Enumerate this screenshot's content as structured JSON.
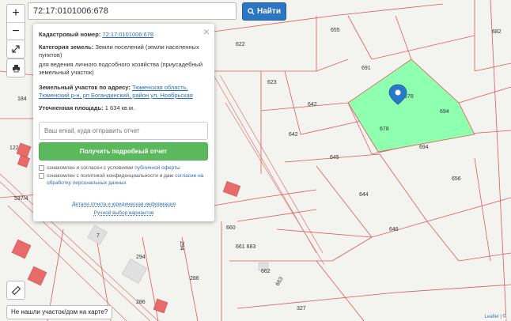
{
  "search": {
    "value": "72:17:0101006:678",
    "button_label": "Найти"
  },
  "zoom": {
    "in_label": "+",
    "out_label": "−"
  },
  "popup": {
    "close_label": "×",
    "cadastral_label": "Кадастровый номер:",
    "cadastral_value": "72:17:0101006:678",
    "category_label": "Категория земель:",
    "category_value": "Земли поселений (земли населенных пунктов)",
    "purpose_value": "для ведения личного подсобного хозяйства (приусадебный земельный участок)",
    "address_label": "Земельный участок по адресу:",
    "address_value": "Тюменская область, Тюменский р-н, рп Богандинский, район ул. Ноябрьская",
    "area_label": "Уточненная площадь:",
    "area_value": "1 634 кв.м.",
    "email_placeholder": "Ваш email, куда отправить отчет",
    "report_button": "Получить подробный отчет",
    "consent_1_prefix": "ознакомлен и согласен с условиями ",
    "consent_1_link": "публичной оферты",
    "consent_2_prefix": "ознакомлен с политикой конфиденциальности и даю ",
    "consent_2_link": "согласие на обработку персональных данных",
    "details_link": "Детали отчета и юридическая информация",
    "manual_link": "Ручной выбор вариантов"
  },
  "not_found_button": "Не нашли участок/дом на карте?",
  "attribution": {
    "leaflet": "Leaflet",
    "separator": " | ©"
  },
  "map_labels": {
    "l655": "655",
    "l682": "682",
    "l622": "622",
    "l691": "691",
    "l623": "623",
    "l184": "184",
    "l642a": "642",
    "l642b": "642",
    "l678a": "678",
    "l678b": "678",
    "l694a": "694",
    "l694b": "694",
    "l122": "122",
    "l645": "645",
    "l656": "656",
    "l644": "644",
    "l537": "537/4",
    "l646": "646",
    "l660": "660",
    "l661": "661 683",
    "l294a": "294",
    "l294b": "294",
    "l662": "662",
    "l286a": "286",
    "l286b": "286",
    "l663": "663",
    "l327": "327",
    "l7": "7"
  },
  "colors": {
    "parcel_line": "#e05a5a",
    "selected_parcel": "#8fffb0",
    "building": "#e86b6b",
    "marker": "#2a78c8",
    "search_button": "#2c75c2",
    "report_button": "#5cb85c"
  }
}
